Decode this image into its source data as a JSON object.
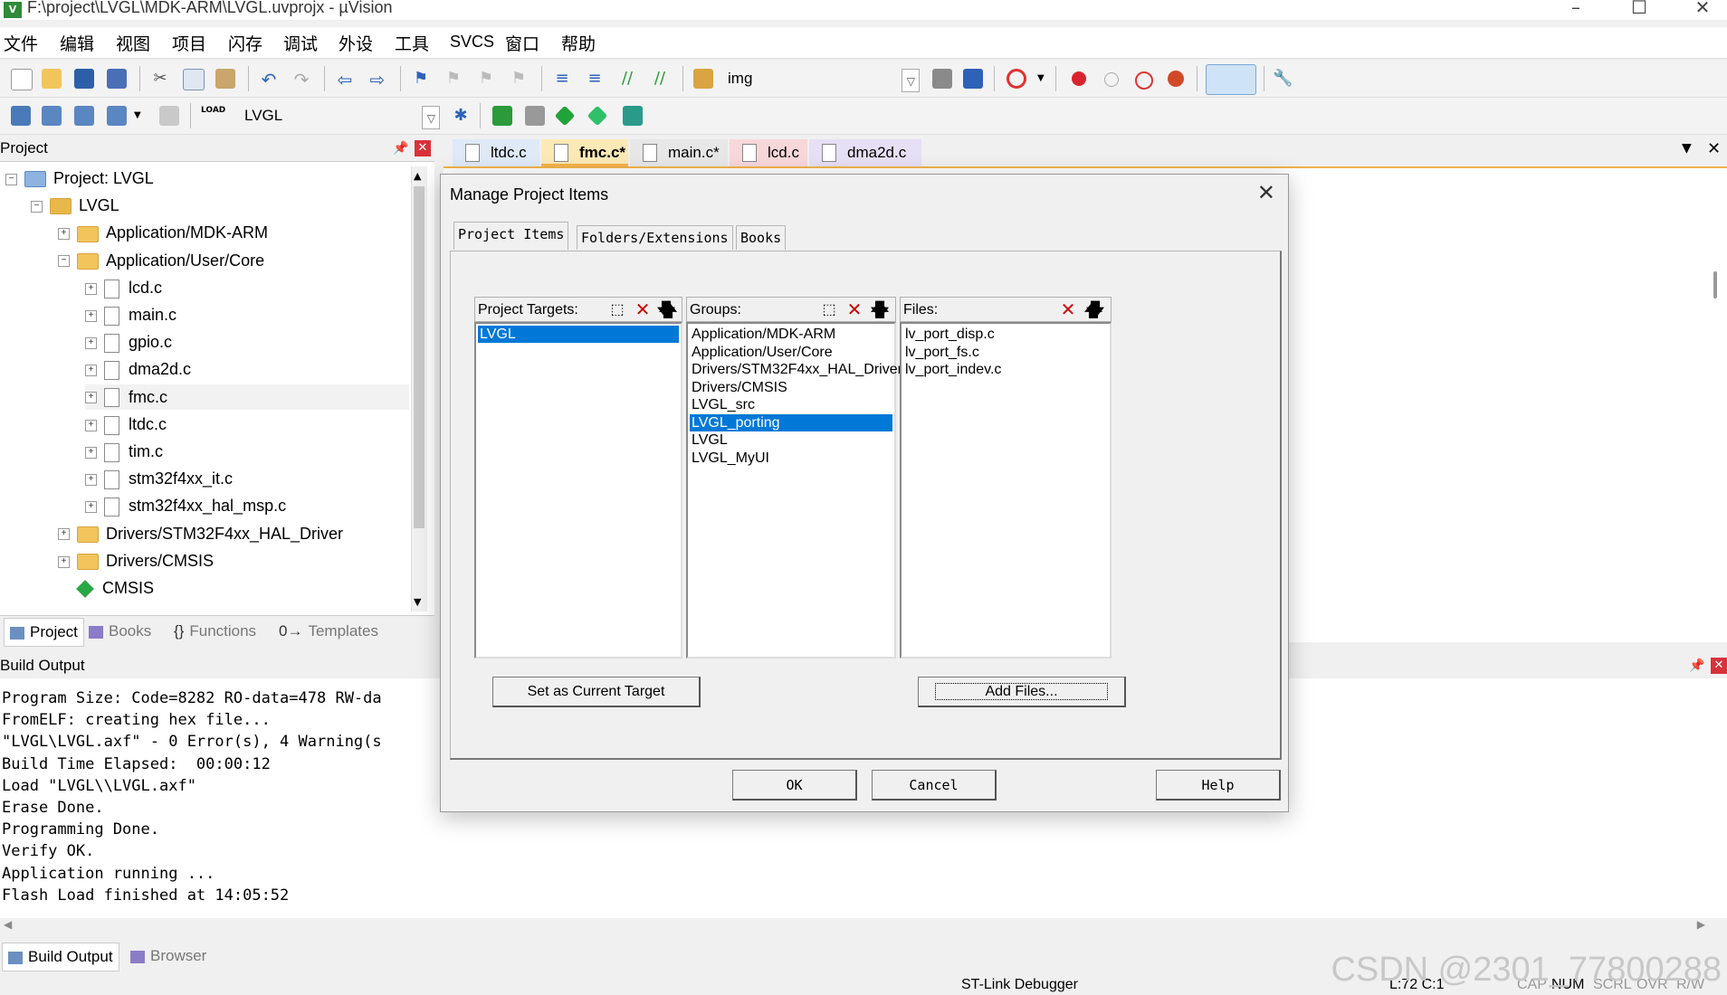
{
  "window": {
    "title": "F:\\project\\LVGL\\MDK-ARM\\LVGL.uvprojx - µVision",
    "app_icon": "V"
  },
  "menu": [
    "文件",
    "编辑",
    "视图",
    "项目",
    "闪存",
    "调试",
    "外设",
    "工具",
    "SVCS",
    "窗口",
    "帮助"
  ],
  "toolbar": {
    "find_combo": "img",
    "target_combo": "LVGL"
  },
  "project_panel": {
    "title": "Project",
    "tree": [
      {
        "label": "Project: LVGL",
        "level": 0,
        "kind": "project",
        "expanded": true
      },
      {
        "label": "LVGL",
        "level": 1,
        "kind": "target",
        "expanded": true
      },
      {
        "label": "Application/MDK-ARM",
        "level": 2,
        "kind": "folder",
        "expanded": false
      },
      {
        "label": "Application/User/Core",
        "level": 2,
        "kind": "folder",
        "expanded": true
      },
      {
        "label": "lcd.c",
        "level": 3,
        "kind": "file"
      },
      {
        "label": "main.c",
        "level": 3,
        "kind": "file"
      },
      {
        "label": "gpio.c",
        "level": 3,
        "kind": "file"
      },
      {
        "label": "dma2d.c",
        "level": 3,
        "kind": "file"
      },
      {
        "label": "fmc.c",
        "level": 3,
        "kind": "file",
        "highlighted": true
      },
      {
        "label": "ltdc.c",
        "level": 3,
        "kind": "file"
      },
      {
        "label": "tim.c",
        "level": 3,
        "kind": "file"
      },
      {
        "label": "stm32f4xx_it.c",
        "level": 3,
        "kind": "file"
      },
      {
        "label": "stm32f4xx_hal_msp.c",
        "level": 3,
        "kind": "file"
      },
      {
        "label": "Drivers/STM32F4xx_HAL_Driver",
        "level": 2,
        "kind": "folder",
        "expanded": false
      },
      {
        "label": "Drivers/CMSIS",
        "level": 2,
        "kind": "folder",
        "expanded": false
      },
      {
        "label": "CMSIS",
        "level": 2,
        "kind": "component"
      }
    ],
    "tabs": [
      "Project",
      "Books",
      "Functions",
      "Templates"
    ]
  },
  "editor_tabs": [
    {
      "label": "ltdc.c",
      "active": false,
      "color": "#dfe9f7"
    },
    {
      "label": "fmc.c*",
      "active": true,
      "color": "#fce9b5"
    },
    {
      "label": "main.c*",
      "active": false,
      "color": "#e7e7e7"
    },
    {
      "label": "lcd.c",
      "active": false,
      "color": "#f7d7da"
    },
    {
      "label": "dma2d.c",
      "active": false,
      "color": "#e7dff5"
    }
  ],
  "build_output": {
    "title": "Build Output",
    "lines": [
      "Program Size: Code=8282 RO-data=478 RW-da",
      "FromELF: creating hex file...",
      "\"LVGL\\LVGL.axf\" - 0 Error(s), 4 Warning(s",
      "Build Time Elapsed:  00:00:12",
      "Load \"LVGL\\\\LVGL.axf\"",
      "Erase Done.",
      "Programming Done.",
      "Verify OK.",
      "Application running ...",
      "Flash Load finished at 14:05:52"
    ],
    "tabs": [
      "Build Output",
      "Browser"
    ]
  },
  "status": {
    "debugger": "ST-Link Debugger",
    "position": "L:72 C:1",
    "indicators": [
      "CAP",
      "NUM",
      "SCRL",
      "OVR",
      "R/W"
    ]
  },
  "watermark": "CSDN @2301_77800288",
  "dialog": {
    "title": "Manage Project Items",
    "tabs": [
      "Project Items",
      "Folders/Extensions",
      "Books"
    ],
    "targets": {
      "header": "Project Targets:",
      "items": [
        "LVGL"
      ],
      "selected": 0
    },
    "groups": {
      "header": "Groups:",
      "items": [
        "Application/MDK-ARM",
        "Application/User/Core",
        "Drivers/STM32F4xx_HAL_Driver",
        "Drivers/CMSIS",
        "LVGL_src",
        "LVGL_porting",
        "LVGL",
        "LVGL_MyUI"
      ],
      "selected": 5
    },
    "files": {
      "header": "Files:",
      "items": [
        "lv_port_disp.c",
        "lv_port_fs.c",
        "lv_port_indev.c"
      ]
    },
    "set_target_label": "Set as Current Target",
    "add_files_label": "Add Files...",
    "ok_label": "OK",
    "cancel_label": "Cancel",
    "help_label": "Help"
  },
  "colors": {
    "selection": "#0078d7",
    "tab_accent": "#f2b24a",
    "close_red": "#d9313a"
  }
}
